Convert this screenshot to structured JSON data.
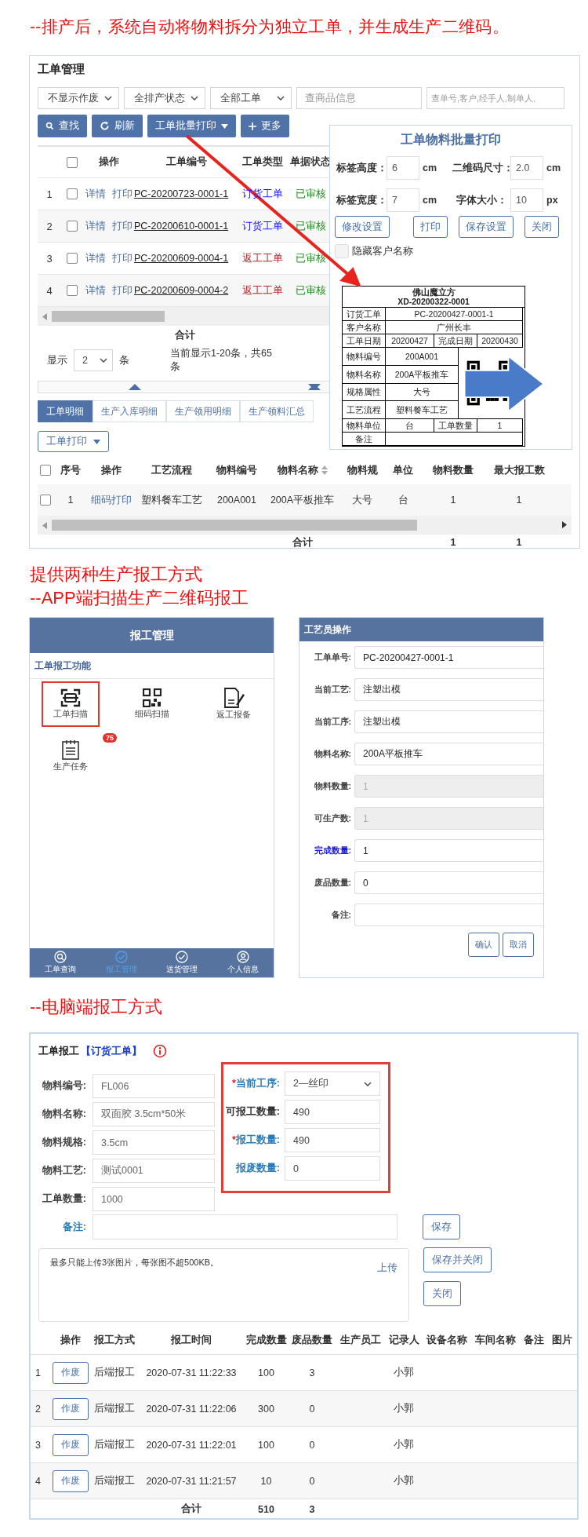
{
  "heading_1": "--排产后，系统自动将物料拆分为独立工单，并生成生产二维码。",
  "work_orders": {
    "title": "工单管理",
    "filters": [
      {
        "kind": "select",
        "value": "不显示作废"
      },
      {
        "kind": "select",
        "value": "全排产状态"
      },
      {
        "kind": "select",
        "value": "全部工单"
      },
      {
        "kind": "input",
        "placeholder": "查商品信息"
      },
      {
        "kind": "input",
        "placeholder": "查单号,客户,经手人,制单人,"
      }
    ],
    "buttons": [
      {
        "kind": "search",
        "label": "查找"
      },
      {
        "kind": "refresh",
        "label": "刷新"
      },
      {
        "kind": "dropdown",
        "label": "工单批量打印"
      },
      {
        "kind": "plus",
        "label": "更多"
      }
    ],
    "table": {
      "all_checked": false,
      "columns": [
        "操作",
        "工单编号",
        "工单类型",
        "单据状态"
      ],
      "rows": [
        {
          "index": "1",
          "checked": false,
          "actions": [
            "详情",
            "打印"
          ],
          "number": "PC-20200723-0001-1",
          "type": "订货工单",
          "color": "#1a1aff",
          "status": "已审核"
        },
        {
          "index": "2",
          "checked": false,
          "actions": [
            "详情",
            "打印"
          ],
          "number": "PC-20200610-0001-1",
          "type": "订货工单",
          "color": "#1a1aff",
          "status": "已审核"
        },
        {
          "index": "3",
          "checked": false,
          "actions": [
            "详情",
            "打印"
          ],
          "number": "PC-20200609-0004-1",
          "type": "返工工单",
          "color": "#b02a2a",
          "status": "已审核"
        },
        {
          "index": "4",
          "checked": false,
          "actions": [
            "详情",
            "打印"
          ],
          "number": "PC-20200609-0004-2",
          "type": "返工工单",
          "color": "#b02a2a",
          "status": "已审核"
        }
      ],
      "total_label": "合计"
    },
    "pager": {
      "prefix": "显示",
      "page_size": "2",
      "suffix": "条",
      "summary": "当前显示1-20条，共65条"
    },
    "tabs": [
      {
        "label": "工单明细",
        "selected": true
      },
      {
        "label": "生产入库明细",
        "selected": false
      },
      {
        "label": "生产领用明细",
        "selected": false
      },
      {
        "label": "生产领料汇总",
        "selected": false
      }
    ],
    "print_button": "工单打印",
    "detail_table": {
      "all_checked": false,
      "columns": [
        "序号",
        "操作",
        "工艺流程",
        "物料编号",
        "物料名称",
        "物料规",
        "单位",
        "物料数量",
        "最大报工数"
      ],
      "rows": [
        {
          "checked": false,
          "cells": [
            "1",
            "细码打印",
            "塑料餐车工艺",
            "200A001",
            "200A平板推车",
            "大号",
            "台",
            "1",
            "1"
          ]
        }
      ],
      "total_label": "合计",
      "totals": [
        "1",
        "1"
      ]
    }
  },
  "print_dialog": {
    "title": "工单物料批量打印",
    "fields": [
      {
        "label": "标签高度：",
        "value": "6",
        "unit": "cm"
      },
      {
        "label": "二维码尺寸：",
        "value": "2.0",
        "unit": "cm"
      },
      {
        "label": "标签宽度：",
        "value": "7",
        "unit": "cm"
      },
      {
        "label": "字体大小：",
        "value": "10",
        "unit": "px"
      }
    ],
    "buttons": [
      "修改设置",
      "打印",
      "保存设置",
      "关闭"
    ],
    "hide_customer": {
      "label": "隐藏客户名称",
      "checked": false
    },
    "label_preview": {
      "company": "佛山魔立方",
      "code": "XD-20200322-0001",
      "rows": [
        {
          "kind": "wide",
          "cells": [
            "订货工单",
            "PC-20200427-0001-1"
          ]
        },
        {
          "kind": "wide",
          "cells": [
            "客户名称",
            "广州长丰"
          ]
        },
        {
          "kind": "pair",
          "cells": [
            "工单日期",
            "20200427",
            "完成日期",
            "20200430"
          ]
        },
        {
          "kind": "qr",
          "cells": [
            "物料编号",
            "200A001"
          ]
        },
        {
          "kind": "qr",
          "cells": [
            "物料名称",
            "200A平板推车"
          ]
        },
        {
          "kind": "qr",
          "cells": [
            "规格属性",
            "大号"
          ]
        },
        {
          "kind": "qr",
          "cells": [
            "工艺流程",
            "塑料餐车工艺"
          ]
        },
        {
          "kind": "pair",
          "cells": [
            "物料单位",
            "台",
            "工单数量",
            "1"
          ]
        },
        {
          "kind": "note",
          "cells": [
            "备注"
          ]
        }
      ]
    }
  },
  "heading_2": [
    "提供两种生产报工方式",
    "--APP端扫描生产二维码报工"
  ],
  "app_screen": {
    "title": "报工管理",
    "section": "工单报工功能",
    "tiles": [
      {
        "kind": "scan",
        "label": "工单扫描",
        "highlighted": true
      },
      {
        "kind": "qr",
        "label": "细码扫描",
        "highlighted": false
      },
      {
        "kind": "rework",
        "label": "返工报备",
        "highlighted": false
      },
      {
        "kind": "task",
        "label": "生产任务",
        "highlighted": false,
        "badge": "75"
      }
    ],
    "nav": [
      {
        "kind": "search",
        "label": "工单查询",
        "selected": false
      },
      {
        "kind": "check",
        "label": "报工管理",
        "selected": true
      },
      {
        "kind": "check",
        "label": "送货管理",
        "selected": false
      },
      {
        "kind": "user",
        "label": "个人信息",
        "selected": false
      }
    ]
  },
  "operator_form": {
    "title": "工艺员操作",
    "fields": [
      {
        "label": "工单单号:",
        "value": "PC-20200427-0001-1",
        "disabled": false,
        "emphasized": false
      },
      {
        "label": "当前工艺:",
        "value": "注塑出模",
        "disabled": false,
        "emphasized": false
      },
      {
        "label": "当前工序:",
        "value": "注塑出模",
        "disabled": false,
        "emphasized": false
      },
      {
        "label": "物料名称:",
        "value": "200A平板推车",
        "disabled": false,
        "emphasized": false
      },
      {
        "label": "物料数量:",
        "value": "1",
        "disabled": true,
        "emphasized": false
      },
      {
        "label": "可生产数:",
        "value": "1",
        "disabled": true,
        "emphasized": false
      },
      {
        "label": "完成数量:",
        "value": "1",
        "disabled": false,
        "emphasized": true
      },
      {
        "label": "废品数量:",
        "value": "0",
        "disabled": false,
        "emphasized": false
      },
      {
        "label": "备注:",
        "disabled": false,
        "emphasized": false
      }
    ],
    "buttons": [
      "确认",
      "取消"
    ]
  },
  "heading_3": "--电脑端报工方式",
  "pc_report": {
    "title": "工单报工",
    "type_tag": "【订货工单】",
    "left_fields": [
      {
        "label": "物料编号:",
        "value": "FL006"
      },
      {
        "label": "物料名称:",
        "value": "双面胶 3.5cm*50米"
      },
      {
        "label": "物料规格:",
        "value": "3.5cm"
      },
      {
        "label": "物料工艺:",
        "value": "测试0001"
      },
      {
        "label": "工单数量:",
        "value": "1000"
      }
    ],
    "right_fields": [
      {
        "kind": "select",
        "mark": "*",
        "label": "当前工序:",
        "value": "2—丝印",
        "emphasized": true
      },
      {
        "kind": "input",
        "label": "可报工数量:",
        "value": "490",
        "emphasized": false
      },
      {
        "kind": "input",
        "mark": "*",
        "label": "报工数量:",
        "value": "490",
        "emphasized": true
      },
      {
        "kind": "input",
        "label": "报废数量:",
        "value": "0",
        "emphasized": true
      }
    ],
    "remark_label": "备注:",
    "upload_hint": "最多只能上传3张图片，每张图不超500KB。",
    "upload_link": "上传",
    "buttons": [
      "保存",
      "保存并关闭",
      "关闭"
    ],
    "table": {
      "columns": [
        "操作",
        "报工方式",
        "报工时间",
        "完成数量",
        "废品数量",
        "生产员工",
        "记录人",
        "设备名称",
        "车间名称",
        "备注",
        "图片"
      ],
      "rows": [
        {
          "index": "1",
          "action": "作废",
          "method": "后端报工",
          "time": "2020-07-31 11:22:33",
          "done": "100",
          "scrap": "3",
          "recorder": "小郭"
        },
        {
          "index": "2",
          "action": "作废",
          "method": "后端报工",
          "time": "2020-07-31 11:22:06",
          "done": "300",
          "scrap": "0",
          "recorder": "小郭"
        },
        {
          "index": "3",
          "action": "作废",
          "method": "后端报工",
          "time": "2020-07-31 11:22:01",
          "done": "100",
          "scrap": "0",
          "recorder": "小郭"
        },
        {
          "index": "4",
          "action": "作废",
          "method": "后端报工",
          "time": "2020-07-31 11:21:57",
          "done": "10",
          "scrap": "0",
          "recorder": "小郭"
        }
      ],
      "total_label": "合计",
      "total_done": "510",
      "total_scrap": "3"
    }
  }
}
